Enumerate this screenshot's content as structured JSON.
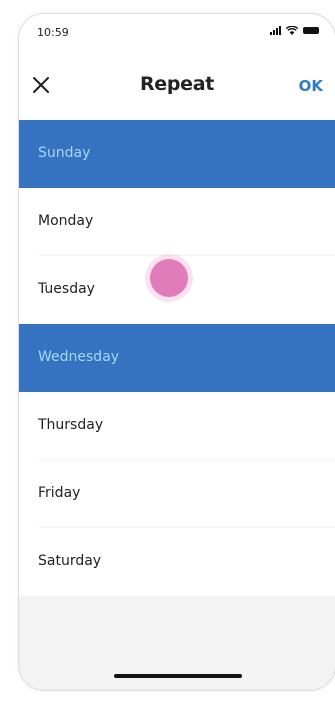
{
  "status_bar": {
    "time": "10:59"
  },
  "header": {
    "title": "Repeat",
    "ok_label": "OK"
  },
  "days": [
    {
      "label": "Sunday",
      "selected": true
    },
    {
      "label": "Monday",
      "selected": false
    },
    {
      "label": "Tuesday",
      "selected": false
    },
    {
      "label": "Wednesday",
      "selected": true
    },
    {
      "label": "Thursday",
      "selected": false
    },
    {
      "label": "Friday",
      "selected": false
    },
    {
      "label": "Saturday",
      "selected": false
    }
  ],
  "colors": {
    "selected_row": "#3572c0",
    "selected_text": "#a8d6ff",
    "accent": "#2f79c9",
    "touch_indicator": "#e07cba"
  },
  "icons": {
    "close": "close-icon",
    "signal": "signal-icon",
    "wifi": "wifi-icon",
    "battery": "battery-icon"
  }
}
